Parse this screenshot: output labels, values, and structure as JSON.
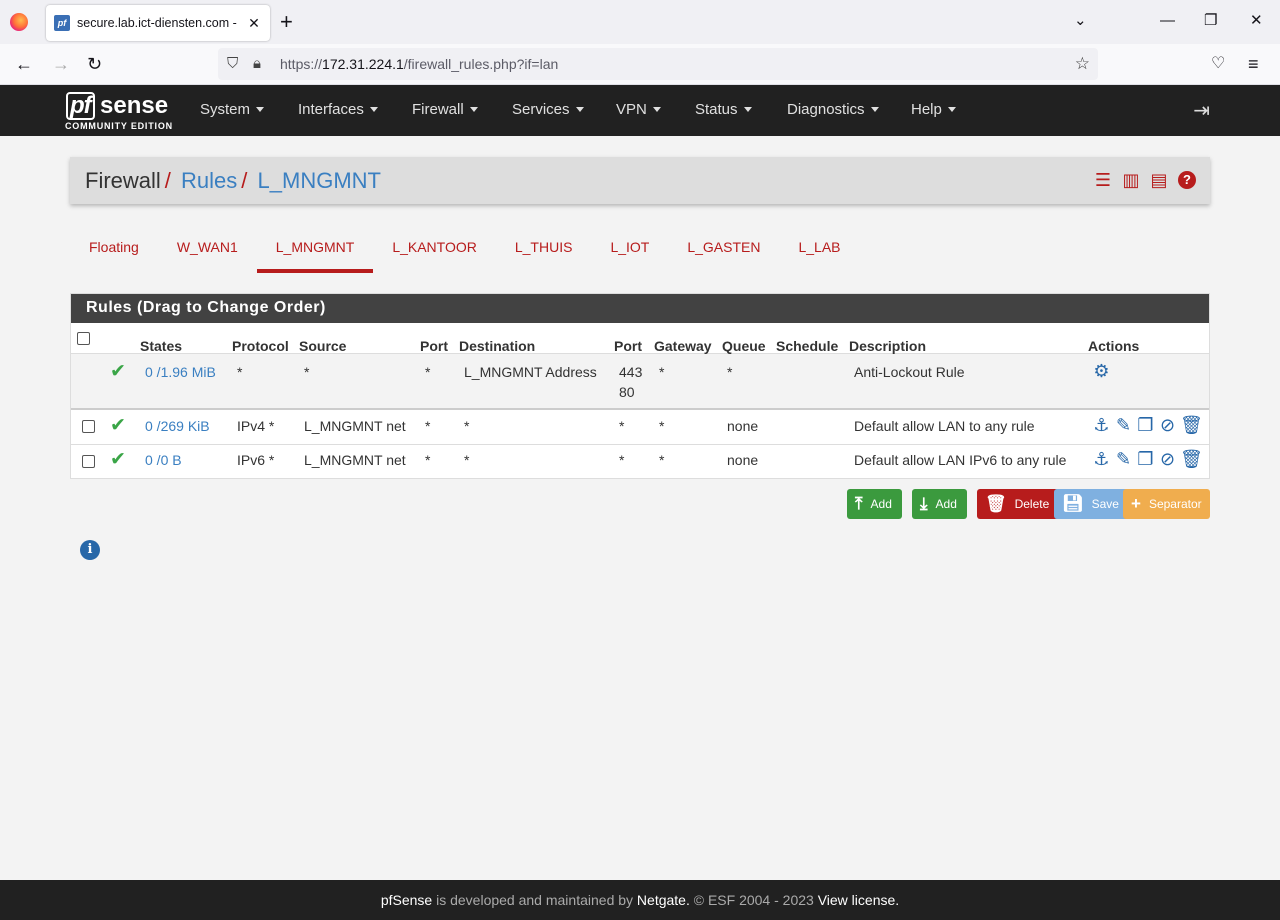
{
  "browser": {
    "tab_title": "secure.lab.ict-diensten.com - Fi",
    "url_scheme": "https://",
    "url_host": "172.31.224.1",
    "url_path": "/firewall_rules.php?if=lan"
  },
  "header": {
    "logo_pf": "pf",
    "logo_sense": "sense",
    "logo_edition": "COMMUNITY EDITION",
    "menu": [
      "System",
      "Interfaces",
      "Firewall",
      "Services",
      "VPN",
      "Status",
      "Diagnostics",
      "Help"
    ]
  },
  "breadcrumb": {
    "part1": "Firewall",
    "part2": "Rules",
    "part3": "L_MNGMNT",
    "sep": "/"
  },
  "tabs": [
    "Floating",
    "W_WAN1",
    "L_MNGMNT",
    "L_KANTOOR",
    "L_THUIS",
    "L_IOT",
    "L_GASTEN",
    "L_LAB"
  ],
  "active_tab": "L_MNGMNT",
  "rules": {
    "title": "Rules (Drag to Change Order)",
    "columns": [
      "States",
      "Protocol",
      "Source",
      "Port",
      "Destination",
      "Port",
      "Gateway",
      "Queue",
      "Schedule",
      "Description",
      "Actions"
    ],
    "rows": [
      {
        "states": "0 /1.96 MiB",
        "protocol": "*",
        "source": "*",
        "src_port": "*",
        "destination": "L_MNGMNT Address",
        "dst_port_1": "443",
        "dst_port_2": "80",
        "gateway": "*",
        "queue": "*",
        "schedule": "",
        "description": "Anti-Lockout Rule"
      },
      {
        "states": "0 /269 KiB",
        "protocol": "IPv4 *",
        "source": "L_MNGMNT net",
        "src_port": "*",
        "destination": "*",
        "dst_port_1": "*",
        "gateway": "*",
        "queue": "none",
        "schedule": "",
        "description": "Default allow LAN to any rule"
      },
      {
        "states": "0 /0 B",
        "protocol": "IPv6 *",
        "source": "L_MNGMNT net",
        "src_port": "*",
        "destination": "*",
        "dst_port_1": "*",
        "gateway": "*",
        "queue": "none",
        "schedule": "",
        "description": "Default allow LAN IPv6 to any rule"
      }
    ]
  },
  "buttons": {
    "add_top": "Add",
    "add_bottom": "Add",
    "delete": "Delete",
    "save": "Save",
    "separator": "Separator"
  },
  "footer": {
    "brand": "pfSense",
    "text1": " is developed and maintained by ",
    "company": "Netgate.",
    "text2": " © ESF 2004 - 2023 ",
    "license": "View license."
  }
}
